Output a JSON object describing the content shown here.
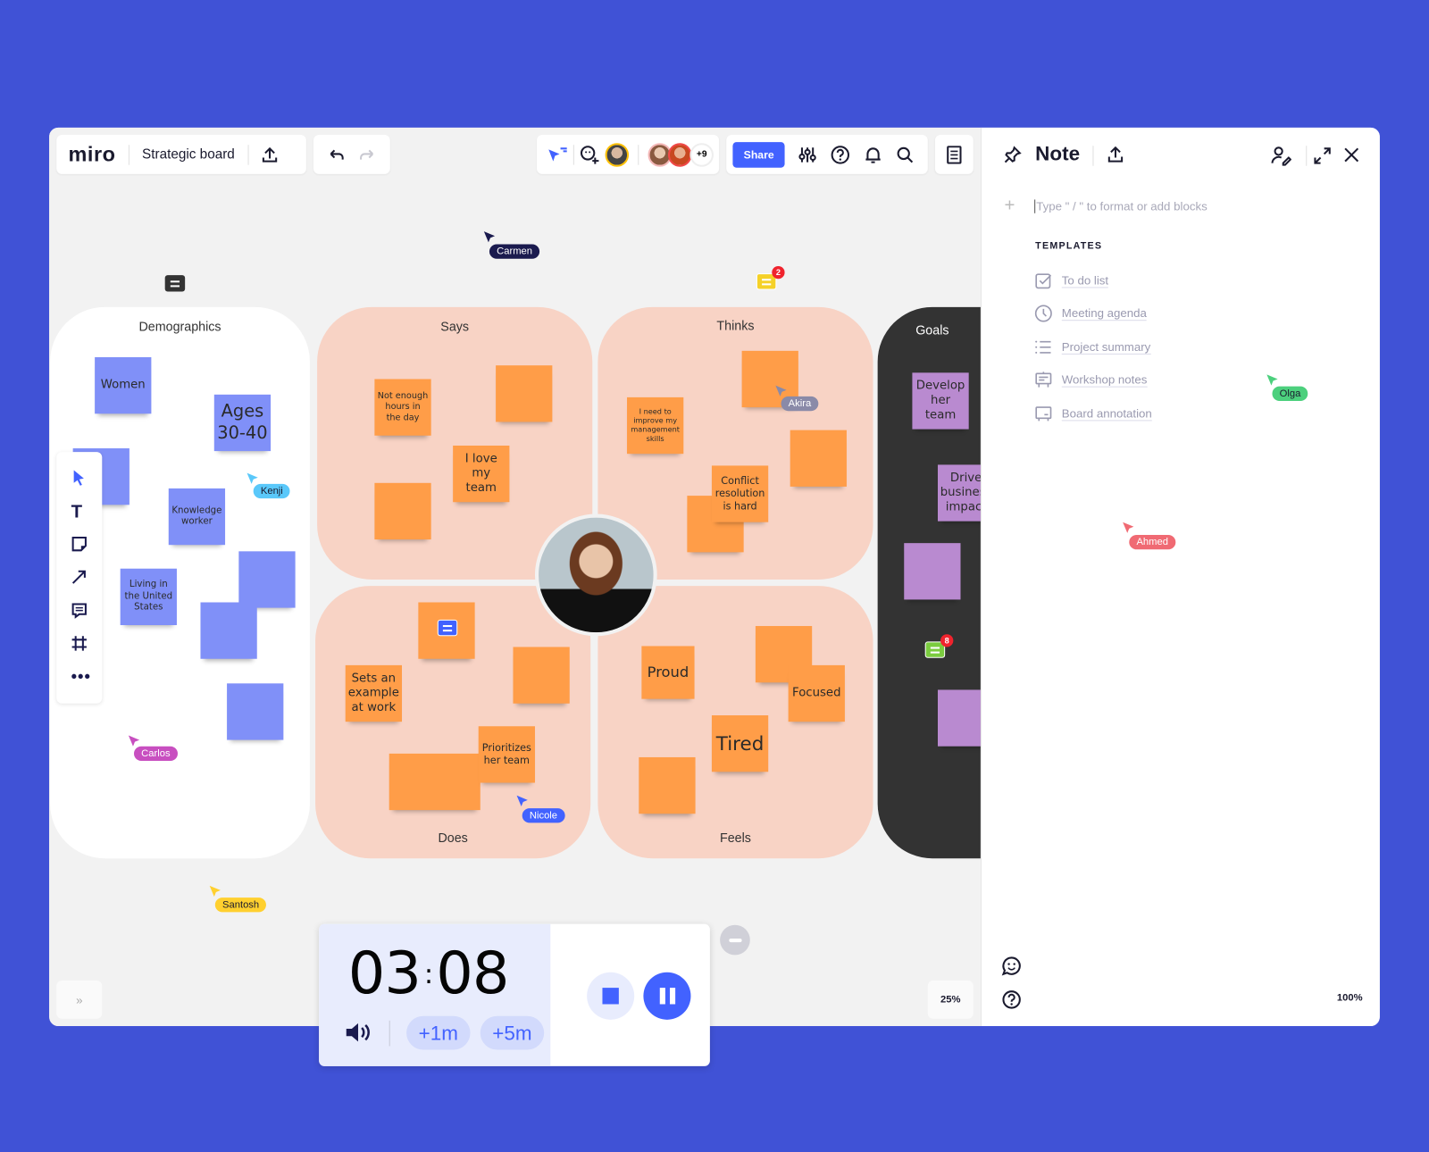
{
  "colors": {
    "background": "#4052d6",
    "accent": "#4262ff",
    "sticky_blue": "#8090f8",
    "sticky_orange": "#ff9d48",
    "sticky_purple": "#b98ad0",
    "frame_peach": "#f8d3c5",
    "frame_dark": "#333333"
  },
  "toolbar": {
    "logo": "miro",
    "board_title": "Strategic board",
    "share_label": "Share",
    "collaborators_extra": "+9"
  },
  "frames": {
    "demographics": "Demographics",
    "says": "Says",
    "thinks": "Thinks",
    "does": "Does",
    "feels": "Feels",
    "goals": "Goals"
  },
  "stickies": [
    {
      "text": "Women",
      "color": "blue"
    },
    {
      "text": "Ages 30-40",
      "color": "blue"
    },
    {
      "text": "",
      "color": "blue"
    },
    {
      "text": "Knowledge worker",
      "color": "blue"
    },
    {
      "text": "",
      "color": "blue"
    },
    {
      "text": "Living in the United States",
      "color": "blue"
    },
    {
      "text": "",
      "color": "blue"
    },
    {
      "text": "",
      "color": "blue"
    },
    {
      "text": "Not enough hours in the day",
      "color": "orange"
    },
    {
      "text": "",
      "color": "orange"
    },
    {
      "text": "I love my team",
      "color": "orange"
    },
    {
      "text": "",
      "color": "orange"
    },
    {
      "text": "",
      "color": "orange"
    },
    {
      "text": "I need to improve my management skills",
      "color": "orange"
    },
    {
      "text": "",
      "color": "orange"
    },
    {
      "text": "",
      "color": "orange"
    },
    {
      "text": "Conflict resolution is hard",
      "color": "orange"
    },
    {
      "text": "",
      "color": "orange"
    },
    {
      "text": "",
      "color": "orange"
    },
    {
      "text": "Sets an example at work",
      "color": "orange"
    },
    {
      "text": "",
      "color": "orange"
    },
    {
      "text": "Prioritizes her team",
      "color": "orange"
    },
    {
      "text": "Proud",
      "color": "orange"
    },
    {
      "text": "",
      "color": "orange"
    },
    {
      "text": "Focused",
      "color": "orange"
    },
    {
      "text": "Tired",
      "color": "orange"
    },
    {
      "text": "",
      "color": "orange"
    },
    {
      "text": "Develop her team",
      "color": "purple"
    },
    {
      "text": "Drive business impact",
      "color": "purple"
    },
    {
      "text": "",
      "color": "purple"
    },
    {
      "text": "",
      "color": "purple"
    }
  ],
  "cursors": [
    {
      "name": "Carmen",
      "color": "#1a1a4e"
    },
    {
      "name": "Kenji",
      "color": "#5ac8fa"
    },
    {
      "name": "Akira",
      "color": "#8a8aa8"
    },
    {
      "name": "Carlos",
      "color": "#c84fc0"
    },
    {
      "name": "Santosh",
      "color": "#ffd02f"
    },
    {
      "name": "Nicole",
      "color": "#4262ff"
    },
    {
      "name": "Olga",
      "color": "#4cd07d"
    },
    {
      "name": "Ahmed",
      "color": "#f06a73"
    }
  ],
  "comments": [
    {
      "count": ""
    },
    {
      "count": "2"
    },
    {
      "count": "8"
    },
    {
      "count": ""
    }
  ],
  "timer": {
    "minutes": "03",
    "seconds": "08",
    "add1": "+1m",
    "add5": "+5m"
  },
  "canvas_zoom": "25%",
  "note": {
    "title": "Note",
    "placeholder": "Type \" / \" to format or add blocks",
    "templates_heading": "TEMPLATES",
    "templates": [
      {
        "label": "To do list",
        "icon": "checkbox-icon"
      },
      {
        "label": "Meeting agenda",
        "icon": "clock-icon"
      },
      {
        "label": "Project summary",
        "icon": "list-icon"
      },
      {
        "label": "Workshop notes",
        "icon": "easel-icon"
      },
      {
        "label": "Board annotation",
        "icon": "board-icon"
      }
    ],
    "zoom": "100%"
  }
}
